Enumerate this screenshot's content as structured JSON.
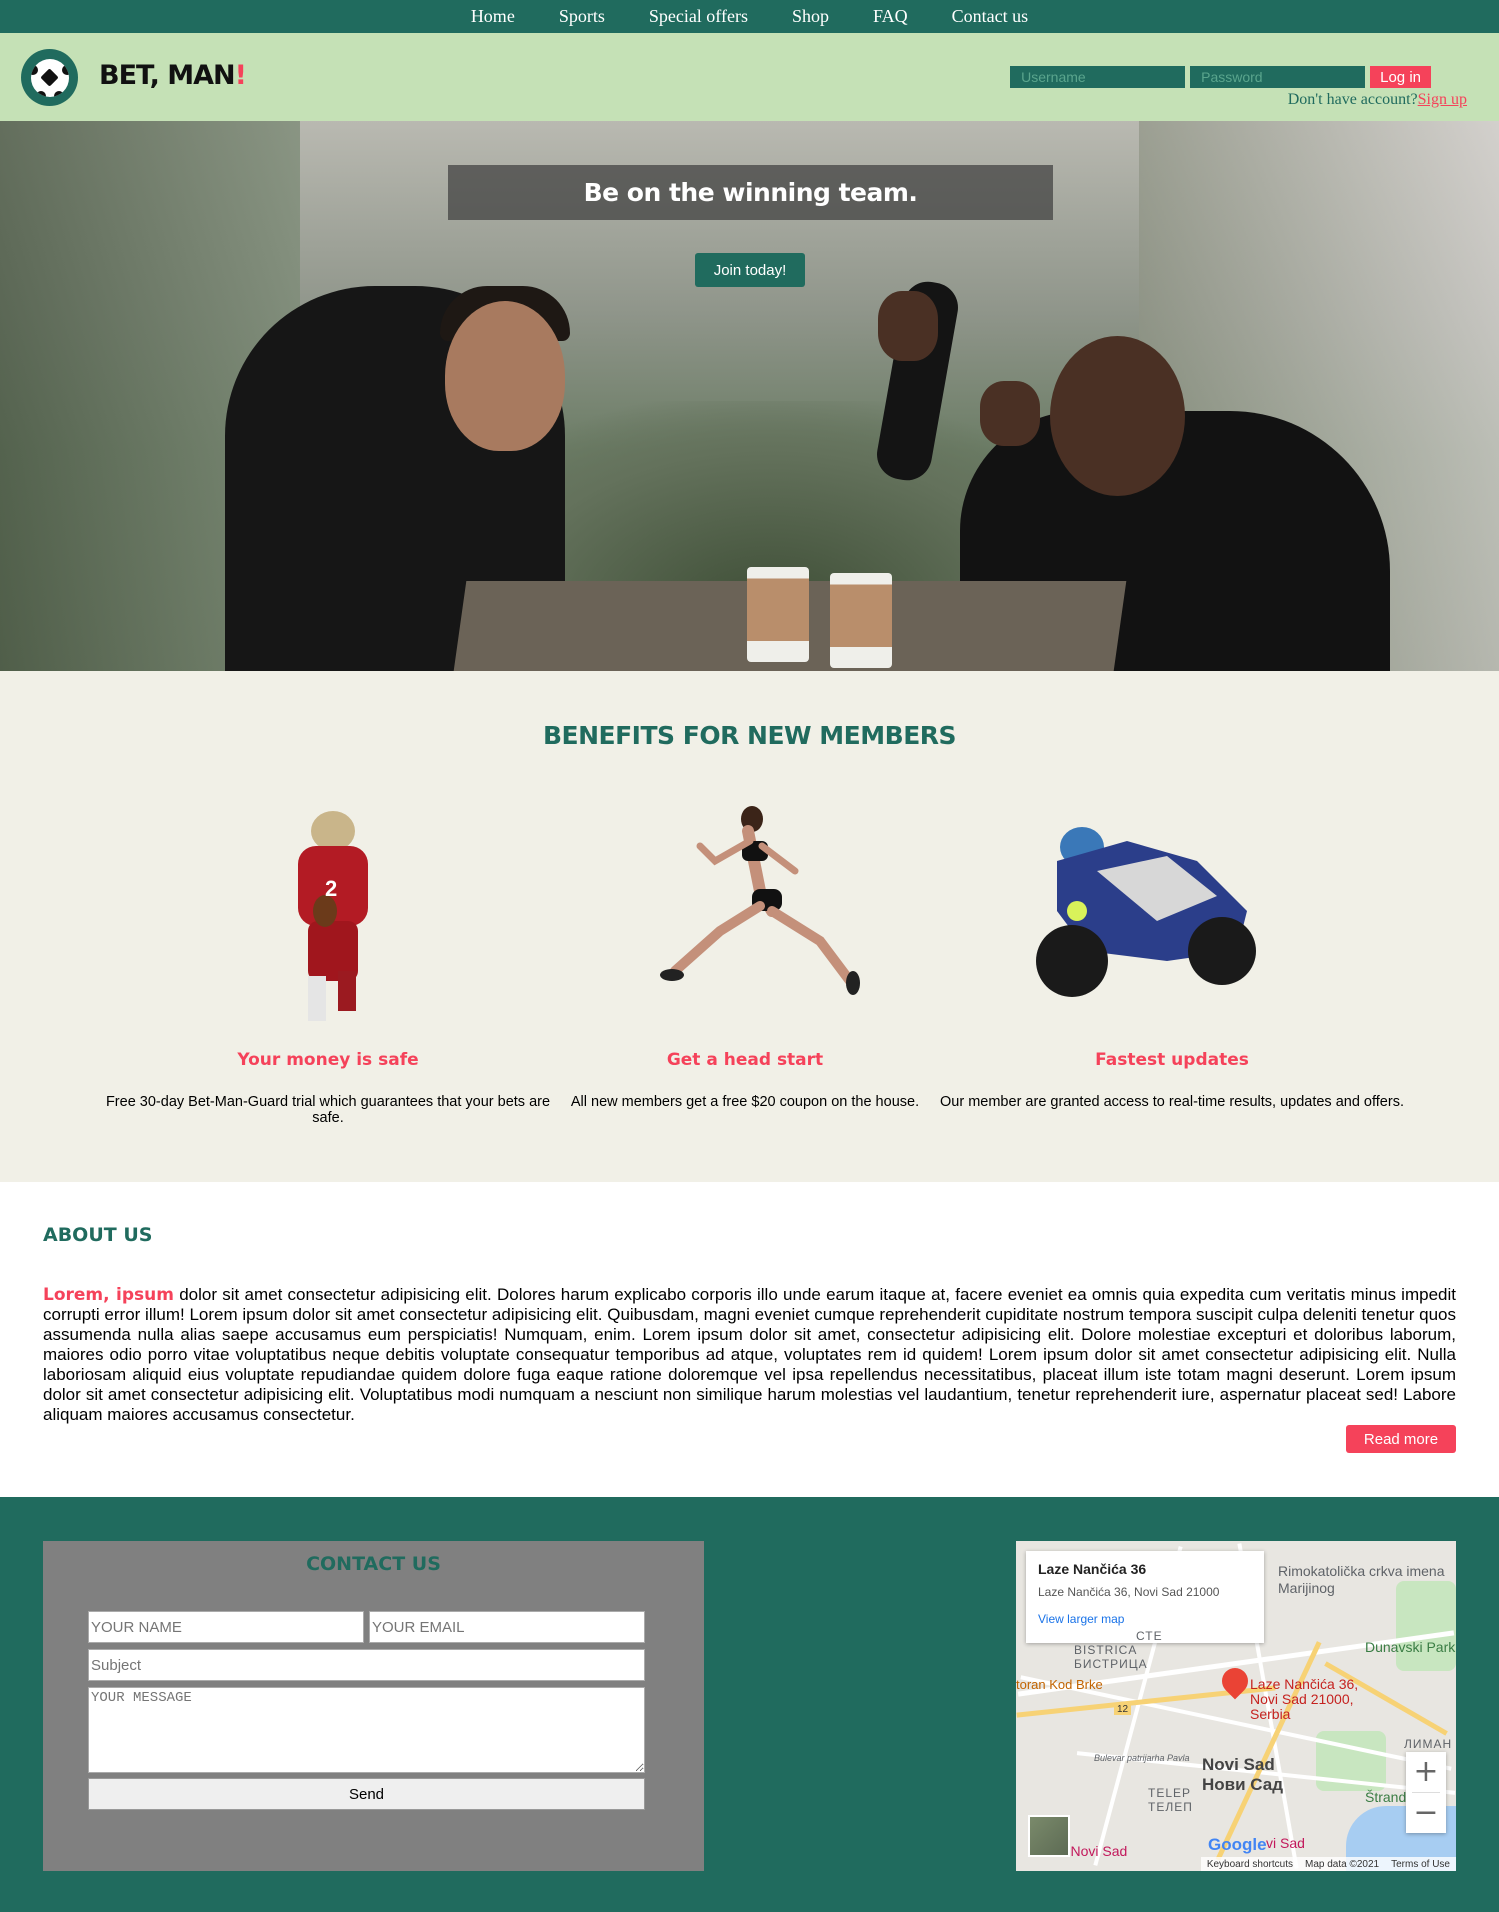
{
  "nav": {
    "items": [
      "Home",
      "Sports",
      "Special offers",
      "Shop",
      "FAQ",
      "Contact us"
    ]
  },
  "header": {
    "brand": "BET, MAN",
    "brand_mark": "!",
    "username_placeholder": "Username",
    "password_placeholder": "Password",
    "login_label": "Log in",
    "signup_prompt": "Don't have account?",
    "signup_link": "Sign up"
  },
  "hero": {
    "title": "Be on the winning team.",
    "cta": "Join today!"
  },
  "benefits": {
    "heading": "BENEFITS FOR NEW MEMBERS",
    "items": [
      {
        "title": "Your money is safe",
        "text": "Free 30-day Bet-Man-Guard trial which guarantees that your bets are safe.",
        "image": "football-player"
      },
      {
        "title": "Get a head start",
        "text": "All new members get a free $20 coupon on the house.",
        "image": "sprinter"
      },
      {
        "title": "Fastest updates",
        "text": "Our member are granted access to real-time results, updates and offers.",
        "image": "motorcycle-racer"
      }
    ]
  },
  "about": {
    "heading": "ABOUT US",
    "lead": "Lorem, ipsum",
    "body": " dolor sit amet consectetur adipisicing elit. Dolores harum explicabo corporis illo unde earum itaque at, facere eveniet ea omnis quia expedita cum veritatis minus impedit corrupti error illum! Lorem ipsum dolor sit amet consectetur adipisicing elit. Quibusdam, magni eveniet cumque reprehenderit cupiditate nostrum tempora suscipit culpa deleniti tenetur quos assumenda nulla alias saepe accusamus eum perspiciatis! Numquam, enim. Lorem ipsum dolor sit amet, consectetur adipisicing elit. Dolore molestiae excepturi et doloribus laborum, maiores odio porro vitae voluptatibus neque debitis voluptate consequatur temporibus ad atque, voluptates rem id quidem! Lorem ipsum dolor sit amet consectetur adipisicing elit. Nulla laboriosam aliquid eius voluptate repudiandae quidem dolore fuga eaque ratione doloremque vel ipsa repellendus necessitatibus, placeat illum iste totam magni deserunt. Lorem ipsum dolor sit amet consectetur adipisicing elit. Voluptatibus modi numquam a nesciunt non similique harum molestias vel laudantium, tenetur reprehenderit iure, aspernatur placeat sed! Labore aliquam maiores accusamus consectetur.",
    "read_more": "Read more"
  },
  "contact": {
    "heading": "CONTACT US",
    "name_placeholder": "YOUR NAME",
    "email_placeholder": "YOUR EMAIL",
    "subject_placeholder": "Subject",
    "message_placeholder": "YOUR MESSAGE",
    "send_label": "Send"
  },
  "map": {
    "place_title": "Laze Nančića 36",
    "place_address": "Laze Nančića 36, Novi Sad 21000",
    "larger_map": "View larger map",
    "pin_label": "Laze Nančića 36, Novi Sad 21000, Serbia",
    "city_latin": "Novi Sad",
    "city_cyrillic": "Нови Сад",
    "labels": [
      "Rimokatolička crkva imena Marijinog",
      "Dunavski Park",
      "BISTRICA",
      "БИСТРИЦА",
      "Štrand",
      "TELEP",
      "ТЕЛЕП",
      "Bulevar patrijarha Pavla",
      "toran Kod Brke",
      "СТЕ",
      "ЛИМАН",
      "ace Novi Sad",
      "vi Sad",
      "12"
    ],
    "google_logo": "Google",
    "footer": [
      "Keyboard shortcuts",
      "Map data ©2021",
      "Terms of Use"
    ],
    "zoom_in": "+",
    "zoom_out": "−"
  },
  "colors": {
    "primary": "#206b5e",
    "accent": "#f5425a",
    "header_bg": "#c5e1b6",
    "benefits_bg": "#f1f0e7"
  }
}
